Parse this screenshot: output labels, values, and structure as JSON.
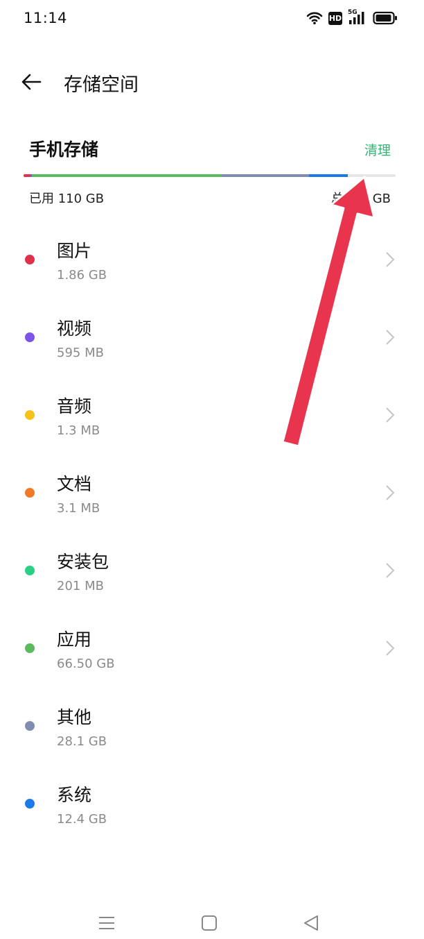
{
  "status_bar": {
    "time": "11:14",
    "network_badge": "HD",
    "cellular_type": "5G",
    "icons": [
      "wifi-icon",
      "hd-icon",
      "signal-5g-icon",
      "battery-icon"
    ]
  },
  "header": {
    "back_icon": "back-arrow-icon",
    "title": "存储空间"
  },
  "storage": {
    "section_title": "手机存储",
    "clean_label": "清理",
    "used_label": "已用 110 GB",
    "total_label": "总容量 GB",
    "accent_color": "#2aba73"
  },
  "items": [
    {
      "name": "图片",
      "size": "1.86 GB",
      "color": "#e0314b"
    },
    {
      "name": "视频",
      "size": "595 MB",
      "color": "#7b55ea"
    },
    {
      "name": "音频",
      "size": "1.3 MB",
      "color": "#f6c21a"
    },
    {
      "name": "文档",
      "size": "3.1 MB",
      "color": "#f07a2a"
    },
    {
      "name": "安装包",
      "size": "201 MB",
      "color": "#2ccf86"
    },
    {
      "name": "应用",
      "size": "66.50  GB",
      "color": "#5cba5e"
    },
    {
      "name": "其他",
      "size": "28.1 GB",
      "color": "#7f8eb0"
    },
    {
      "name": "系统",
      "size": "12.4 GB",
      "color": "#1c7ae8"
    }
  ],
  "usage_bar": [
    {
      "category": "图片",
      "fraction": 0.017,
      "color": "#e0314b"
    },
    {
      "category": "视频",
      "fraction": 0.005,
      "color": "#7b55ea"
    },
    {
      "category": "应用",
      "fraction": 0.51,
      "color": "#5cba5e"
    },
    {
      "category": "其他",
      "fraction": 0.235,
      "color": "#7f8eb0"
    },
    {
      "category": "系统",
      "fraction": 0.105,
      "color": "#1c7ae8"
    }
  ],
  "annotation": {
    "arrow_color": "#e8344d"
  },
  "nav_bar": {
    "icons": [
      "menu-icon",
      "home-icon",
      "back-icon"
    ]
  }
}
